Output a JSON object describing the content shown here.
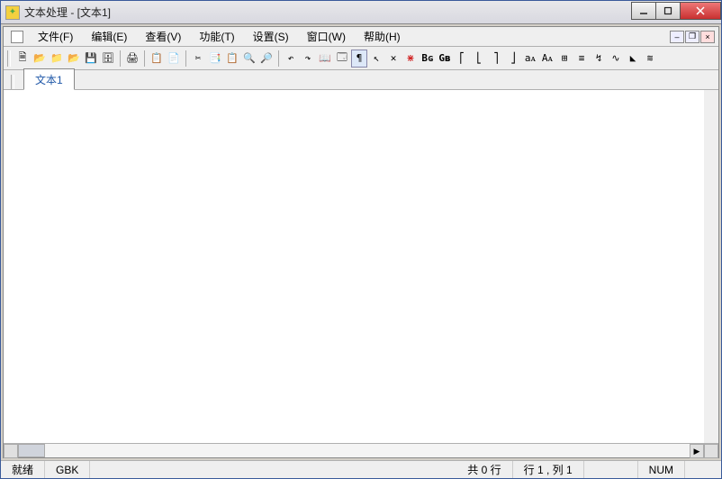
{
  "window": {
    "title": "文本处理 - [文本1]"
  },
  "menu": {
    "file": "文件(F)",
    "edit": "编辑(E)",
    "view": "查看(V)",
    "function": "功能(T)",
    "settings": "设置(S)",
    "window": "窗口(W)",
    "help": "帮助(H)"
  },
  "toolbar_icons": {
    "new": "🗎",
    "open": "📂",
    "open2": "📁",
    "open3": "📂",
    "save": "💾",
    "saveall": "🗄",
    "print": "🖨",
    "copy": "📋",
    "paste": "📄",
    "cut": "✂",
    "copy2": "📑",
    "paste2": "📋",
    "find": "🔍",
    "findnext": "🔎",
    "undo": "↶",
    "redo": "↷",
    "book": "📖",
    "props": "🗔",
    "para": "¶",
    "wand": "↖",
    "x": "✕",
    "red": "⋇",
    "bg": "Bɢ",
    "gb": "Gʙ",
    "b1": "⎡",
    "b2": "⎣",
    "b3": "⎤",
    "b4": "⎦",
    "aa1": "aᴀ",
    "aa2": "Aᴀ",
    "col": "⊞",
    "num": "≡",
    "arr": "↯",
    "link": "∿",
    "tri": "◣",
    "misc": "≋"
  },
  "tabs": {
    "doc1": "文本1"
  },
  "editor": {
    "content": ""
  },
  "status": {
    "ready": "就绪",
    "encoding": "GBK",
    "lines": "共 0 行",
    "position": "行 1 , 列 1",
    "numlock": "NUM"
  }
}
